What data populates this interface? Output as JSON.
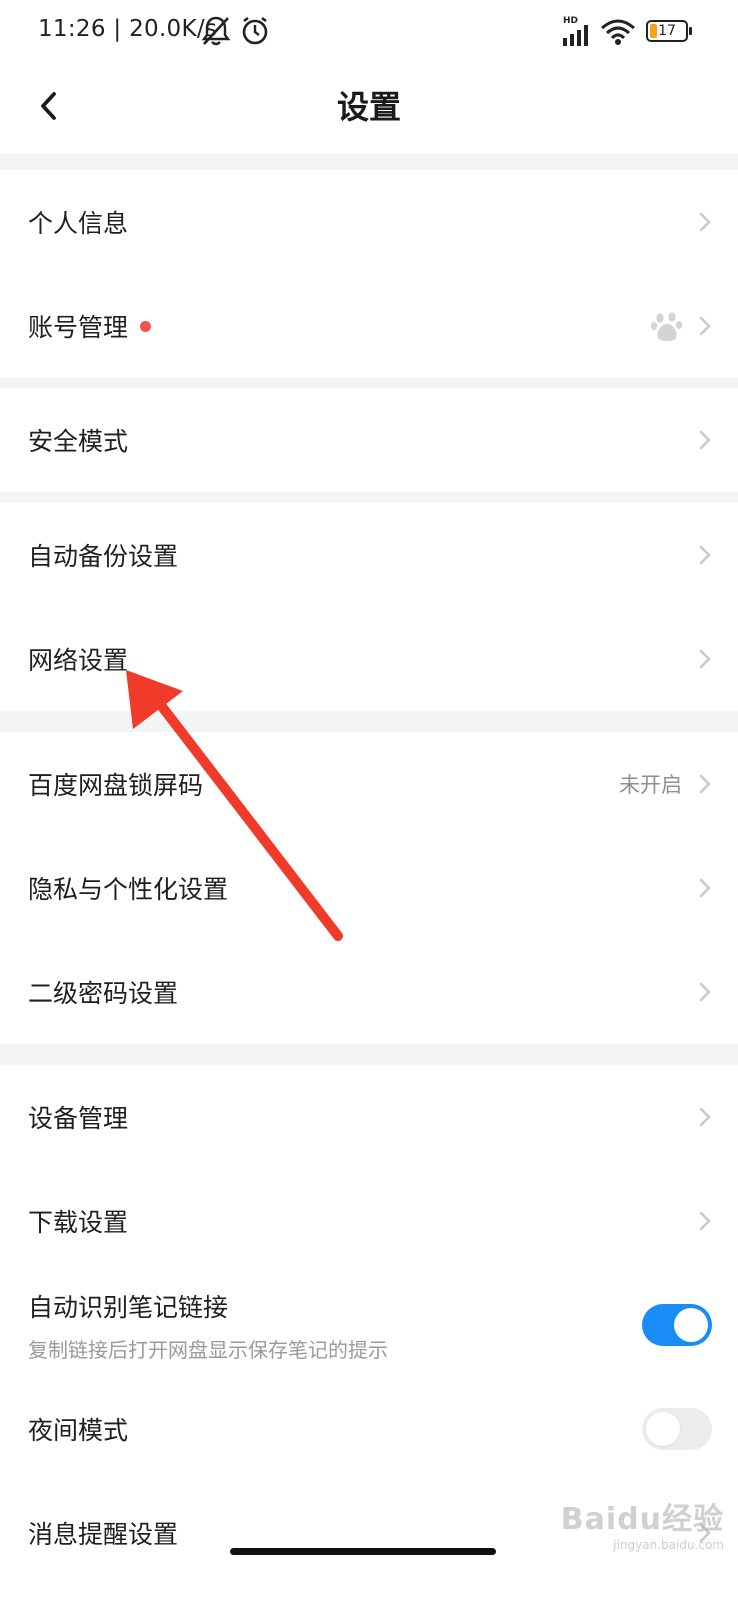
{
  "status_bar": {
    "time": "11:26",
    "network_speed": "20.0K/s",
    "signal_label": "HD",
    "battery_level": "17"
  },
  "header": {
    "title": "设置"
  },
  "groups": [
    {
      "items": [
        {
          "label": "个人信息"
        },
        {
          "label": "账号管理",
          "has_dot": true,
          "icon": "baidu-paw-icon"
        }
      ]
    },
    {
      "items": [
        {
          "label": "安全模式"
        }
      ]
    },
    {
      "items": [
        {
          "label": "自动备份设置"
        },
        {
          "label": "网络设置"
        }
      ]
    },
    {
      "items": [
        {
          "label": "百度网盘锁屏码",
          "value": "未开启"
        },
        {
          "label": "隐私与个性化设置"
        },
        {
          "label": "二级密码设置"
        }
      ]
    },
    {
      "items": [
        {
          "label": "设备管理"
        },
        {
          "label": "下载设置"
        },
        {
          "label": "自动识别笔记链接",
          "subtitle": "复制链接后打开网盘显示保存笔记的提示",
          "toggle": "on"
        },
        {
          "label": "夜间模式",
          "toggle": "off"
        },
        {
          "label": "消息提醒设置"
        }
      ]
    }
  ],
  "watermark": {
    "main": "Baidu经验",
    "sub": "jingyan.baidu.com"
  },
  "colors": {
    "accent": "#1a8cf5",
    "annotation_arrow": "#f03a2a",
    "dot": "#f2524e",
    "background": "#f3f4f6"
  }
}
